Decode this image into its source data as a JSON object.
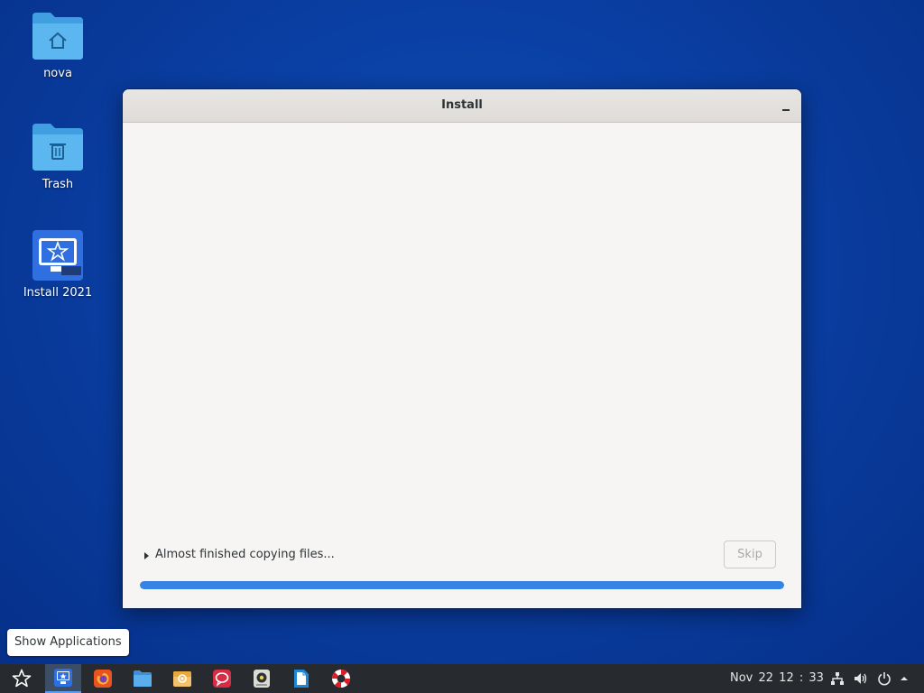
{
  "desktop": {
    "icons": [
      {
        "label": "nova",
        "icon": "home-folder-icon"
      },
      {
        "label": "Trash",
        "icon": "trash-folder-icon"
      },
      {
        "label": "Install  2021",
        "icon": "installer-icon"
      }
    ]
  },
  "window": {
    "title": "Install",
    "minimize_label": "_",
    "status_text": "Almost finished copying files...",
    "skip_label": "Skip",
    "progress": 1.0
  },
  "tooltip": {
    "text": "Show Applications"
  },
  "taskbar": {
    "items": [
      {
        "name": "show-applications",
        "icon": "star-icon"
      },
      {
        "name": "installer",
        "icon": "installer-icon",
        "active": true
      },
      {
        "name": "firefox",
        "icon": "firefox-icon"
      },
      {
        "name": "files",
        "icon": "folder-icon"
      },
      {
        "name": "mail",
        "icon": "mail-icon"
      },
      {
        "name": "chat",
        "icon": "chat-icon"
      },
      {
        "name": "music",
        "icon": "music-icon"
      },
      {
        "name": "document",
        "icon": "document-icon"
      },
      {
        "name": "help",
        "icon": "lifebuoy-icon"
      }
    ],
    "clock": "Nov 22  12 : 33",
    "tray": [
      "network-icon",
      "volume-icon",
      "power-icon",
      "tray-arrow-icon"
    ]
  },
  "colors": {
    "accent": "#3584e4",
    "desktop_bg": "#0a3fa3",
    "taskbar_bg": "#272a2e"
  }
}
